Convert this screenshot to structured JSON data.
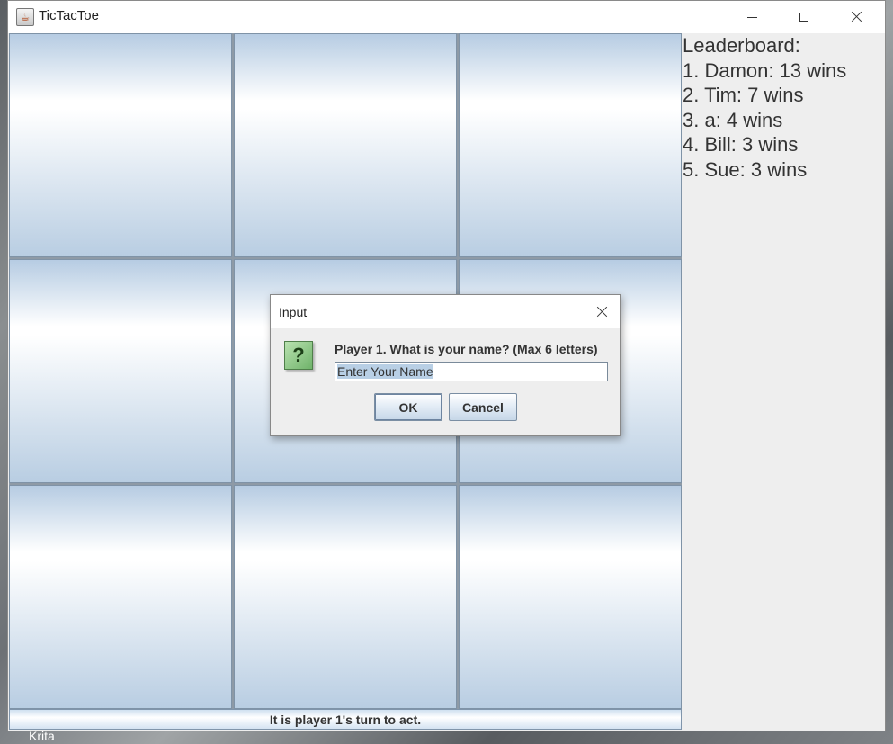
{
  "window": {
    "title": "TicTacToe",
    "controls": {
      "minimize": "minimize-icon",
      "maximize": "maximize-icon",
      "close": "close-icon"
    }
  },
  "board": {
    "cells": [
      "",
      "",
      "",
      "",
      "",
      "",
      "",
      "",
      ""
    ]
  },
  "status": {
    "text": "It is player 1's turn to act."
  },
  "leaderboard": {
    "heading": "Leaderboard:",
    "entries": [
      "1. Damon: 13 wins",
      "2. Tim: 7 wins",
      "3. a: 4 wins",
      "4. Bill: 3 wins",
      "5. Sue: 3 wins"
    ]
  },
  "dialog": {
    "title": "Input",
    "icon": "question-icon",
    "icon_glyph": "?",
    "prompt": "Player 1. What is your name? (Max 6 letters)",
    "input_value": "Enter Your Name",
    "ok_label": "OK",
    "cancel_label": "Cancel"
  },
  "desktop": {
    "taskbar_label": "Krita"
  }
}
